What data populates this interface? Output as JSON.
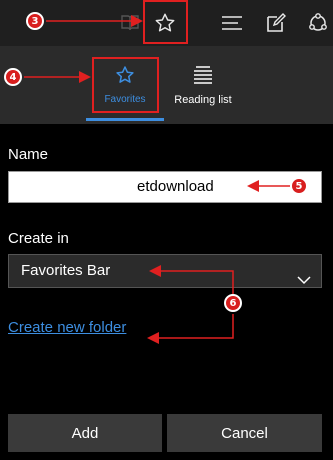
{
  "toolbar": {
    "icons": [
      "reading-view-icon",
      "star-icon",
      "hub-menu-icon",
      "web-note-icon",
      "share-icon"
    ]
  },
  "tabs": [
    {
      "label": "Favorites",
      "active": true
    },
    {
      "label": "Reading list",
      "active": false
    }
  ],
  "form": {
    "name_label": "Name",
    "name_value": "etdownload",
    "create_in_label": "Create in",
    "folder_selected": "Favorites Bar",
    "create_folder_link": "Create new folder"
  },
  "buttons": {
    "add": "Add",
    "cancel": "Cancel"
  },
  "annotations": {
    "step3": "3",
    "step4": "4",
    "step5": "5",
    "step6": "6"
  },
  "colors": {
    "accent": "#3d8ee0",
    "annotation_red": "#e02020",
    "panel_bg": "#2b2b2b",
    "background": "#000000"
  }
}
